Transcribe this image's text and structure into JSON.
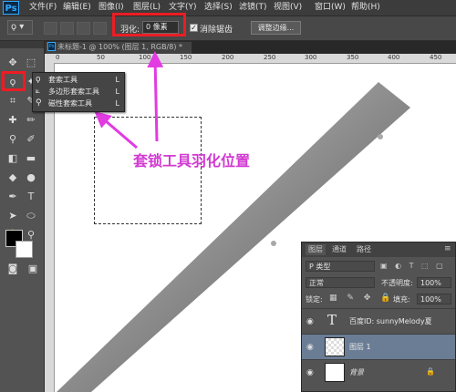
{
  "app": {
    "logo": "Ps"
  },
  "menu": [
    "文件(F)",
    "编辑(E)",
    "图像(I)",
    "图层(L)",
    "文字(Y)",
    "选择(S)",
    "滤镜(T)",
    "视图(V)",
    "窗口(W)",
    "帮助(H)"
  ],
  "options": {
    "feather_label": "羽化:",
    "feather_value": "0 像素",
    "anti_alias_label": "消除锯齿",
    "anti_alias_checked": true,
    "refine_edge_label": "调整边缘..."
  },
  "flyout": [
    {
      "icon": "lasso-icon",
      "label": "套索工具",
      "key": "L"
    },
    {
      "icon": "polygonal-lasso-icon",
      "label": "多边形套索工具",
      "key": "L"
    },
    {
      "icon": "magnetic-lasso-icon",
      "label": "磁性套索工具",
      "key": "L"
    }
  ],
  "document": {
    "tab_title": "未标题-1 @ 100% (图层 1, RGB/8) *"
  },
  "ruler_h": [
    "0",
    "50",
    "100",
    "150",
    "200",
    "250",
    "300",
    "350",
    "400",
    "450"
  ],
  "annotation": "套锁工具羽化位置",
  "layers_panel": {
    "tabs": [
      "图层",
      "通道",
      "路径"
    ],
    "filter": "P 类型",
    "blend_mode": "正常",
    "opacity_label": "不透明度:",
    "opacity_value": "100%",
    "lock_label": "锁定:",
    "fill_label": "填充:",
    "fill_value": "100%",
    "layers": [
      {
        "name": "百度ID: sunnyMelody夏",
        "type": "text",
        "selected": false
      },
      {
        "name": "图层 1",
        "type": "pixel",
        "selected": true
      },
      {
        "name": "背景",
        "type": "background",
        "selected": false
      }
    ]
  },
  "colors": {
    "highlight_red": "#ec1d24",
    "annotation_magenta": "#d23ad2",
    "selected_layer": "#6b7d95"
  }
}
